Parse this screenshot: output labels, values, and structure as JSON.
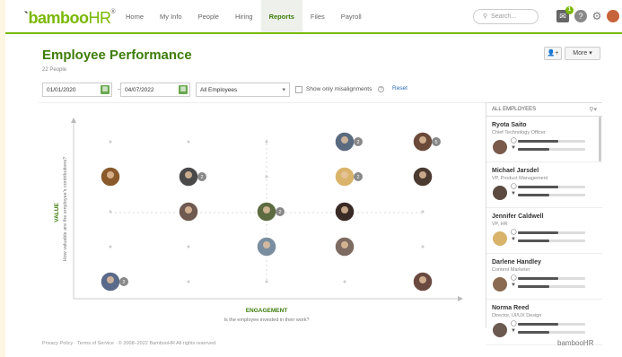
{
  "app": {
    "logo": "bamboo",
    "logo_suffix": "HR",
    "reg": "®",
    "logo_tick": "ˋ"
  },
  "nav": [
    {
      "label": "Home",
      "active": false
    },
    {
      "label": "My Info",
      "active": false
    },
    {
      "label": "People",
      "active": false
    },
    {
      "label": "Hiring",
      "active": false
    },
    {
      "label": "Reports",
      "active": true
    },
    {
      "label": "Files",
      "active": false
    },
    {
      "label": "Payroll",
      "active": false
    }
  ],
  "search": {
    "placeholder": "Search..."
  },
  "notifications": {
    "count": "1"
  },
  "header": {
    "title": "Employee Performance",
    "people_count": "22 People"
  },
  "toolbar": {
    "more_label": "More",
    "add_icon": "person-add-icon"
  },
  "filters": {
    "start_date": "01/01/2020",
    "end_date": "04/07/2022",
    "employee_select": "All Employees",
    "misalign_label": "Show only misalignments",
    "reset_label": "Reset"
  },
  "axes": {
    "y_title": "VALUE",
    "y_question": "How valuable are the employee's contributions?",
    "x_title": "ENGAGEMENT",
    "x_question": "Is the employee invested in their work?"
  },
  "grid_points": [
    {
      "col": 4,
      "row": 1,
      "extra": "2",
      "color": "#5a6b80"
    },
    {
      "col": 5,
      "row": 1,
      "extra": "5",
      "color": "#6b4a3a"
    },
    {
      "col": 1,
      "row": 2,
      "extra": "",
      "color": "#8a5a2b"
    },
    {
      "col": 2,
      "row": 2,
      "extra": "2",
      "color": "#4a4a4a"
    },
    {
      "col": 4,
      "row": 2,
      "extra": "2",
      "color": "#d9b36a"
    },
    {
      "col": 5,
      "row": 2,
      "extra": "",
      "color": "#4a3a30"
    },
    {
      "col": 2,
      "row": 3,
      "extra": "",
      "color": "#6e5a50"
    },
    {
      "col": 3,
      "row": 3,
      "extra": "2",
      "color": "#5c6b40"
    },
    {
      "col": 4,
      "row": 3,
      "extra": "",
      "color": "#3a2a25"
    },
    {
      "col": 3,
      "row": 4,
      "extra": "",
      "color": "#7a8ea0"
    },
    {
      "col": 4,
      "row": 4,
      "extra": "",
      "color": "#7d6a60"
    },
    {
      "col": 1,
      "row": 5,
      "extra": "2",
      "color": "#5a6a8a"
    },
    {
      "col": 5,
      "row": 5,
      "extra": "",
      "color": "#6a4a40"
    }
  ],
  "sidebar": {
    "header": "ALL EMPLOYEES",
    "employees": [
      {
        "name": "Ryota Saito",
        "role": "Chief Technology Officer",
        "color": "#7a5a4a"
      },
      {
        "name": "Michael Jarsdel",
        "role": "VP, Product Management",
        "color": "#5a4a40"
      },
      {
        "name": "Jennifer Caldwell",
        "role": "VP, HR",
        "color": "#d9b36a"
      },
      {
        "name": "Darlene Handley",
        "role": "Content Marketer",
        "color": "#8a6a50"
      },
      {
        "name": "Norma Reed",
        "role": "Director, UI/UX Design",
        "color": "#6a5a50"
      }
    ]
  },
  "footer": {
    "text": "Privacy Policy · Terms of Service · © 2008–2022 BambooHR All rights reserved.",
    "logo": "bambooHR"
  }
}
